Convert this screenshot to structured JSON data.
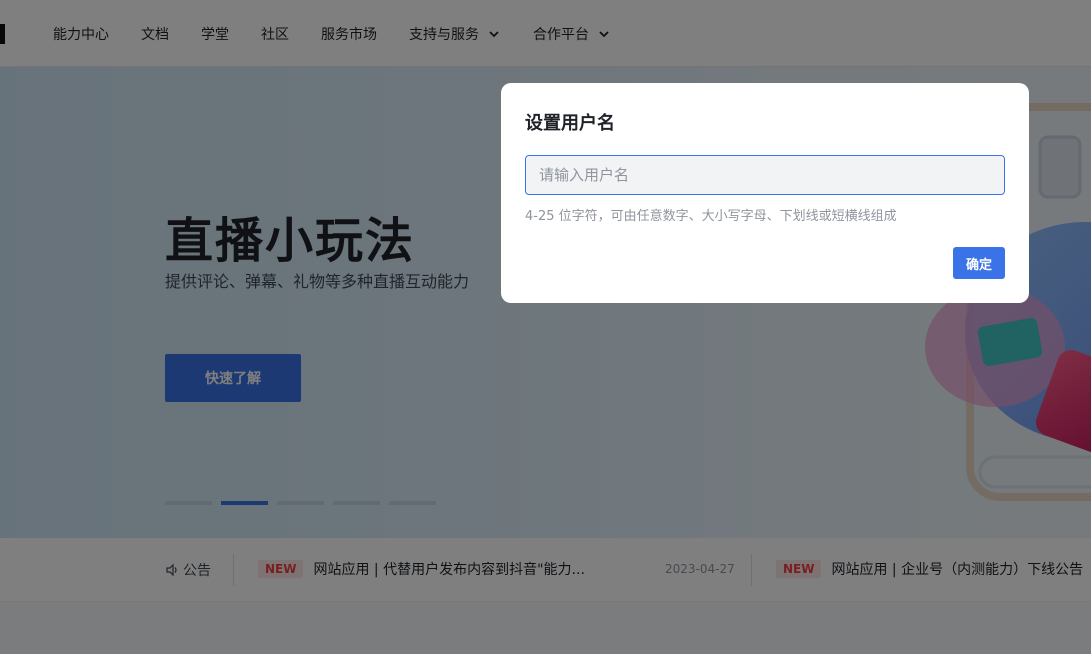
{
  "nav": {
    "items": [
      {
        "label": "能力中心"
      },
      {
        "label": "文档"
      },
      {
        "label": "学堂"
      },
      {
        "label": "社区"
      },
      {
        "label": "服务市场"
      },
      {
        "label": "支持与服务"
      },
      {
        "label": "合作平台"
      }
    ]
  },
  "hero": {
    "title": "直播小玩法",
    "subtitle": "提供评论、弹幕、礼物等多种直播互动能力",
    "cta_label": "快速了解",
    "carousel": {
      "count": 5,
      "active_index": 1
    }
  },
  "announcement": {
    "label": "公告",
    "items": [
      {
        "badge": "NEW",
        "text": "网站应用 | 代替用户发布内容到抖音\"能力...",
        "date": "2023-04-27"
      },
      {
        "badge": "NEW",
        "text": "网站应用 | 企业号（内测能力）下线公告"
      }
    ]
  },
  "modal": {
    "title": "设置用户名",
    "input_value": "",
    "input_placeholder": "请输入用户名",
    "hint": "4-25 位字符，可由任意数字、大小写字母、下划线或短横线组成",
    "confirm_label": "确定"
  },
  "colors": {
    "accent": "#3a73e8",
    "overlay": "rgba(0,0,0,0.5)",
    "badge_new": "#f04142"
  }
}
